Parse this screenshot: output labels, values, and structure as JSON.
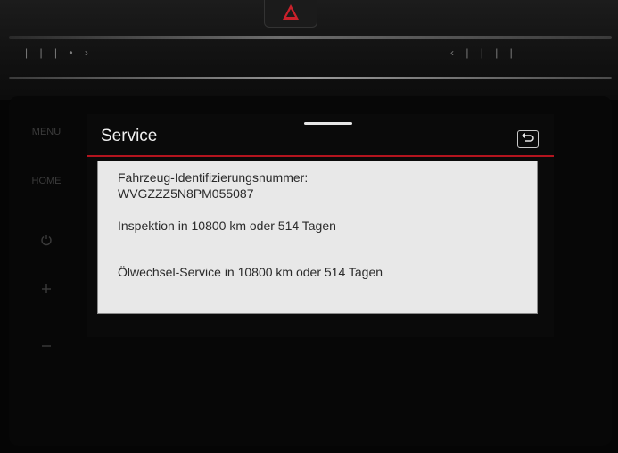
{
  "dashboard": {
    "hazard_icon": "hazard-warning-icon",
    "side_buttons": [
      "MENU",
      "HOME"
    ],
    "power_icon": "power-icon",
    "volume_up_icon": "plus-icon",
    "volume_down_icon": "minus-icon"
  },
  "screen": {
    "title": "Service",
    "back_icon": "back-arrow-icon",
    "colors": {
      "accent": "#b3141e",
      "panel_bg": "#e8e8e8"
    }
  },
  "service_info": {
    "vin_label": "Fahrzeug-Identifizierungsnummer:",
    "vin": "WVGZZZ5N8PM055087",
    "inspection": "Inspektion in 10800 km oder 514 Tagen",
    "oil_service": "Ölwechsel-Service in 10800 km oder 514 Tagen"
  }
}
